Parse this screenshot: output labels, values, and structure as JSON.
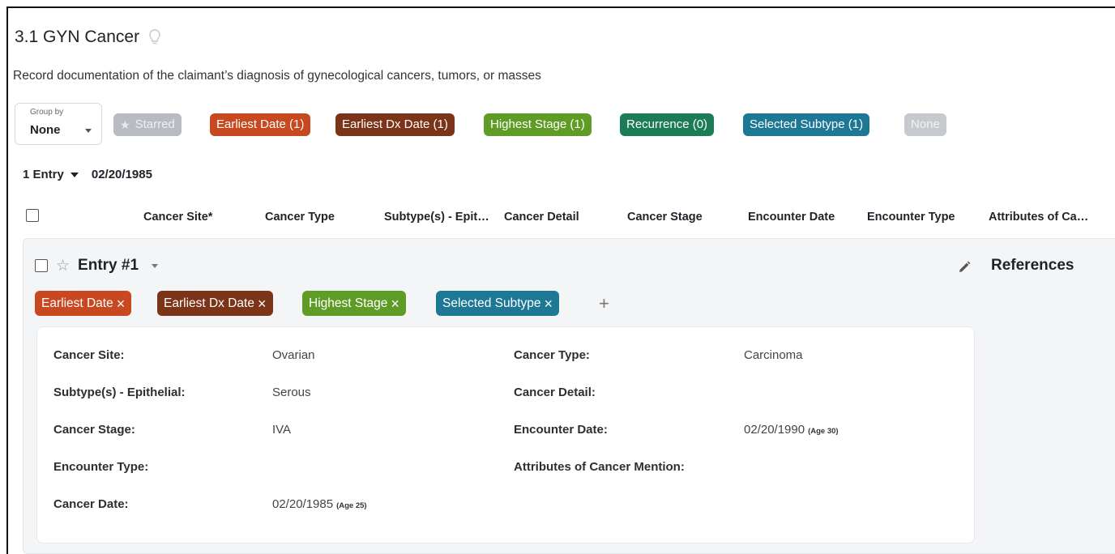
{
  "header": {
    "title": "3.1 GYN Cancer",
    "description": "Record documentation of the claimant’s diagnosis of gynecological cancers, tumors, or masses"
  },
  "group_by": {
    "label": "Group by",
    "value": "None"
  },
  "filters": [
    {
      "label": "Starred",
      "color": "#b8bcc2",
      "icon": "star-icon"
    },
    {
      "label": "Earliest Date (1)",
      "color": "#c8481f"
    },
    {
      "label": "Earliest Dx Date (1)",
      "color": "#7b3418"
    },
    {
      "label": "Highest Stage (1)",
      "color": "#5e9c25"
    },
    {
      "label": "Recurrence (0)",
      "color": "#1b7c56"
    },
    {
      "label": "Selected Subtype (1)",
      "color": "#1d7896"
    },
    {
      "label": "None",
      "color": "#c6c9cd"
    }
  ],
  "entries_bar": {
    "count_label": "1 Entry",
    "date": "02/20/1985"
  },
  "columns": [
    "Cancer Site*",
    "Cancer Type",
    "Subtype(s) - Epit…",
    "Cancer Detail",
    "Cancer Stage",
    "Encounter Date",
    "Encounter Type",
    "Attributes of Ca…"
  ],
  "entry": {
    "title": "Entry #1",
    "references_label": "References",
    "tags": [
      {
        "label": "Earliest Date",
        "color": "#c8481f"
      },
      {
        "label": "Earliest Dx Date",
        "color": "#7b3418"
      },
      {
        "label": "Highest Stage",
        "color": "#5e9c25"
      },
      {
        "label": "Selected Subtype",
        "color": "#1d7896"
      }
    ],
    "add_tag": "+",
    "fields": {
      "cancer_site": {
        "label": "Cancer Site:",
        "value": "Ovarian"
      },
      "cancer_type": {
        "label": "Cancer Type:",
        "value": "Carcinoma"
      },
      "subtype": {
        "label": "Subtype(s) - Epithelial:",
        "value": "Serous"
      },
      "cancer_detail": {
        "label": "Cancer Detail:",
        "value": ""
      },
      "cancer_stage": {
        "label": "Cancer Stage:",
        "value": "IVA"
      },
      "encounter_date": {
        "label": "Encounter Date:",
        "value": "02/20/1990",
        "age": "(Age 30)"
      },
      "encounter_type": {
        "label": "Encounter Type:",
        "value": ""
      },
      "attributes": {
        "label": "Attributes of Cancer Mention:",
        "value": ""
      },
      "cancer_date": {
        "label": "Cancer Date:",
        "value": "02/20/1985",
        "age": "(Age 25)"
      }
    }
  }
}
